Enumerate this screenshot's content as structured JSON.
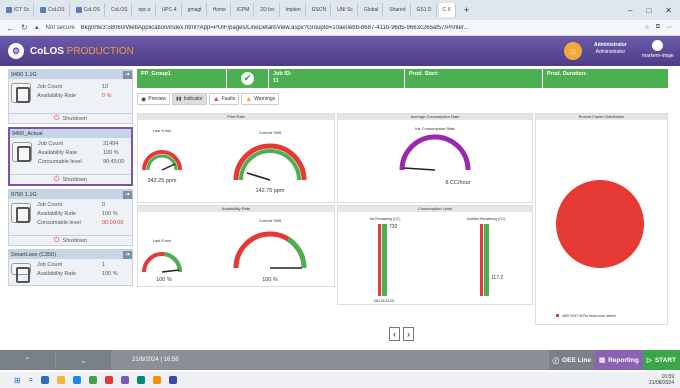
{
  "browser": {
    "tabs": [
      "ICT Sc",
      "CoLOS",
      "CoLOS",
      "CoLOS",
      "opc.e",
      "UPC-4",
      "gmagt",
      "Home",
      "ICPM",
      "2D loc",
      "Implen",
      "GSCN",
      "UNI Sc",
      "Global",
      "Shared",
      "GS1 D",
      "C X"
    ],
    "not_secure": "Not secure",
    "url": "Bkg0rfw3:58060/WebApplication/index.html?App=PUIF/pages/LineDetailsView.aspx?GroupId=10ae0ebb-b687-411b-96d5-9663c265af57/Printer..."
  },
  "app": {
    "title_main": "CoLOS",
    "title_sub": "PRODUCTION",
    "user_name": "Administrator",
    "user_role": "Administrator",
    "user_extra": "markem-imaje"
  },
  "sidebar": {
    "cards": [
      {
        "name": "9450 1.1G",
        "rows": [
          {
            "label": "Job Count",
            "value": "10"
          },
          {
            "label": "Availability Rate",
            "value": "0 %"
          }
        ],
        "shutdown": "Shutdown"
      },
      {
        "name": "9450_Actual",
        "rows": [
          {
            "label": "Job Count",
            "value": "31494"
          },
          {
            "label": "Availability Rate",
            "value": "100 %"
          },
          {
            "label": "Consumable level",
            "value": "90:45:00"
          }
        ],
        "shutdown": "Shutdown"
      },
      {
        "name": "9750 1.1G",
        "rows": [
          {
            "label": "Job Count",
            "value": "0"
          },
          {
            "label": "Availability Rate",
            "value": "100 %"
          },
          {
            "label": "Consumable level",
            "value": "00:00:00"
          }
        ],
        "shutdown": "Shutdown"
      },
      {
        "name": "SmartLase (C350)",
        "rows": [
          {
            "label": "Job Count",
            "value": "1"
          },
          {
            "label": "Availability Rate",
            "value": "100 %"
          }
        ]
      }
    ]
  },
  "main": {
    "header": {
      "group": "PP_Group1",
      "job_id_label": "Job ID:",
      "job_id": "11",
      "prod_start_label": "Prod. Start:",
      "prod_duration_label": "Prod. Duration:"
    },
    "tabs": [
      "Preview",
      "Indicator",
      "Faults",
      "Warnings"
    ],
    "panels": {
      "print_rate": {
        "title": "Print Rate",
        "left_title": "Last 5 min",
        "left_value": "342.25 ppm",
        "right_title": "Current Shift",
        "right_value": "142.75 ppm"
      },
      "avg_consumption": {
        "title": "Average Consumption Rate",
        "sub": "Ink Consumption Rate",
        "value": "8 CC/hour"
      },
      "faults_dist": {
        "title": "Recent Faults Distribution",
        "legend": "9450 09:57:49 Ptu Head cover absent"
      },
      "availability": {
        "title": "Availability Rate",
        "left_title": "Last 5 min",
        "left_value": "100 %",
        "right_title": "Current Shift",
        "right_value": "100 %"
      },
      "consumption_level": {
        "title": "Consumption Level",
        "left_sub": "Ink Remaining (CC)",
        "left_value": "720",
        "left_date": "05d 18:43:00",
        "right_sub": "Additive Remaining (CC)",
        "right_value": "117.2"
      }
    }
  },
  "footer": {
    "date": "21/8/2024 | 16:58",
    "oee": "OEE Line",
    "reporting": "Reporting",
    "start": "START"
  },
  "taskbar": {
    "time": "16:59",
    "date": "21/08/2024"
  }
}
